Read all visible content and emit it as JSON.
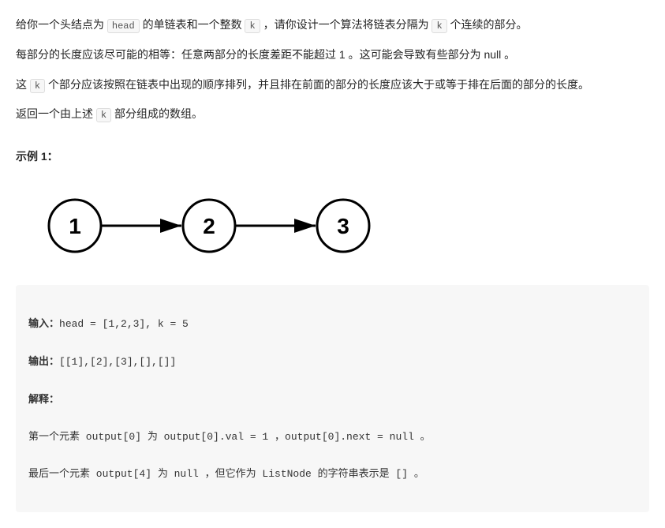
{
  "para1": {
    "t1": "给你一个头结点为 ",
    "c1": "head",
    "t2": " 的单链表和一个整数 ",
    "c2": "k",
    "t3": " ，请你设计一个算法将链表分隔为 ",
    "c3": "k",
    "t4": " 个连续的部分。"
  },
  "para2": "每部分的长度应该尽可能的相等：任意两部分的长度差距不能超过 1 。这可能会导致有些部分为 null 。",
  "para3": {
    "t1": "这 ",
    "c1": "k",
    "t2": " 个部分应该按照在链表中出现的顺序排列，并且排在前面的部分的长度应该大于或等于排在后面的部分的长度。"
  },
  "para4": {
    "t1": "返回一个由上述 ",
    "c1": "k",
    "t2": " 部分组成的数组。"
  },
  "exampleTitle": "示例 1：",
  "diagram": {
    "nodes": [
      "1",
      "2",
      "3"
    ]
  },
  "code": {
    "inLabel": "输入：",
    "inVal": "head = [1,2,3], k = 5",
    "outLabel": "输出：",
    "outVal": "[[1],[2],[3],[],[]]",
    "expLabel": "解释：",
    "line1": "第一个元素 output[0] 为 output[0].val = 1 ，output[0].next = null 。",
    "line2": "最后一个元素 output[4] 为 null ，但它作为 ListNode 的字符串表示是 [] 。"
  }
}
